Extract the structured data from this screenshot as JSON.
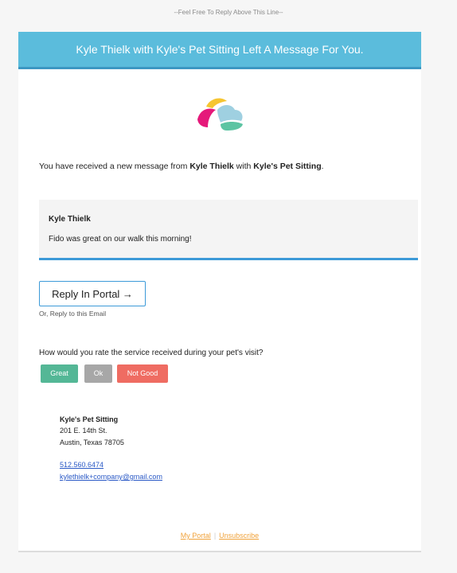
{
  "header_note": "--Feel Free To Reply Above This Line--",
  "banner": {
    "title": "Kyle Thielk with Kyle's Pet Sitting Left A Message For You."
  },
  "intro": {
    "prefix": "You have received a new message from ",
    "sender": "Kyle Thielk",
    "middle": " with ",
    "company": "Kyle's Pet Sitting",
    "suffix": "."
  },
  "message": {
    "author": "Kyle Thielk",
    "text": "Fido was great on our walk this morning!"
  },
  "reply": {
    "button_label": "Reply In Portal →",
    "alt_text": "Or, Reply to this Email"
  },
  "rating": {
    "question": "How would you rate the service received during your pet's visit?",
    "great": "Great",
    "ok": "Ok",
    "not_good": "Not Good"
  },
  "business": {
    "name": "Kyle's Pet Sitting",
    "address_line1": "201 E. 14th St.",
    "address_line2": "Austin, Texas 78705",
    "phone": "512.560.6474",
    "email": "kylethielk+company@gmail.com"
  },
  "footer": {
    "portal_link": "My Portal",
    "unsubscribe_link": "Unsubscribe"
  },
  "colors": {
    "banner": "#5bbcdc",
    "accent_blue": "#3c9ad8",
    "great": "#54b796",
    "ok": "#a7a7a7",
    "not_good": "#ef6c62",
    "footer_link": "#f0a23a"
  }
}
